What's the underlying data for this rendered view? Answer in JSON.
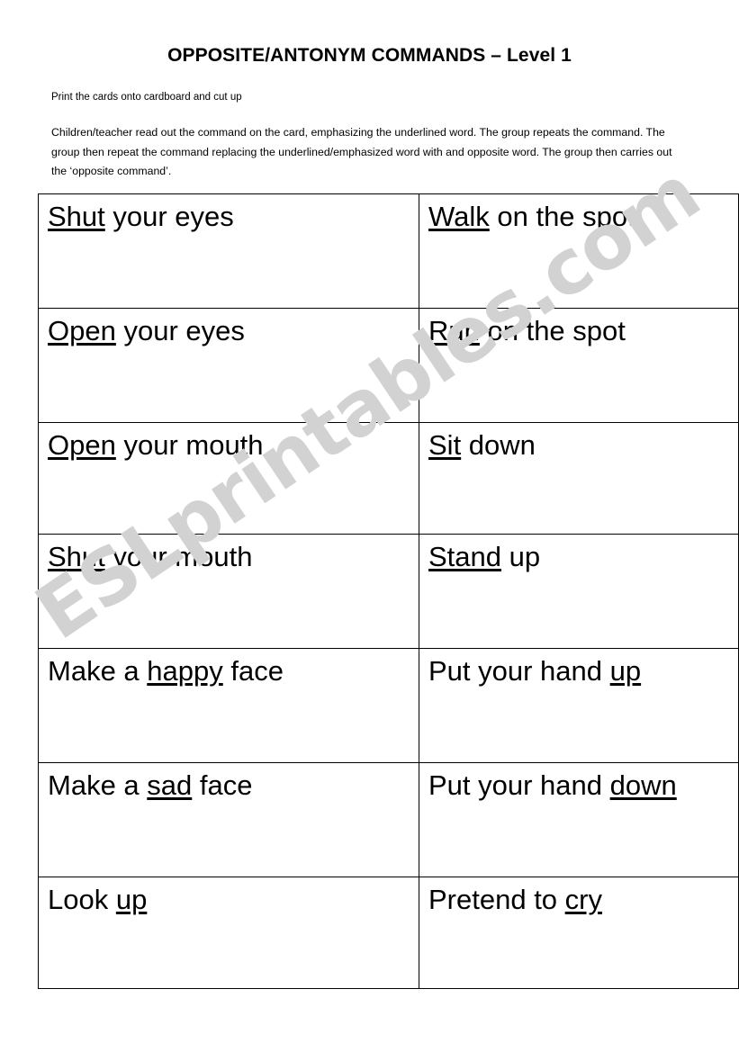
{
  "document": {
    "title": "OPPOSITE/ANTONYM COMMANDS – Level 1",
    "instruction_line": "Print the cards onto cardboard and cut up",
    "instruction_paragraph": "Children/teacher read out the command on the card, emphasizing the underlined word.  The group repeats the command.  The group then repeat the command replacing the underlined/emphasized word with and opposite word.  The group then carries out the ‘opposite command’."
  },
  "watermark": {
    "text_bold": "ESL",
    "text_rest": "printables.com",
    "full_text": "ESLprintables.com",
    "color": "#d2d2d2"
  },
  "cards": {
    "rows": [
      {
        "left": {
          "before": "",
          "emphasis": "Shut",
          "after": " your eyes"
        },
        "right": {
          "before": "",
          "emphasis": "Walk",
          "after": " on the spot"
        }
      },
      {
        "left": {
          "before": "",
          "emphasis": "Open",
          "after": " your eyes"
        },
        "right": {
          "before": "",
          "emphasis": "Run",
          "after": " on the spot"
        }
      },
      {
        "left": {
          "before": "",
          "emphasis": "Open",
          "after": " your mouth"
        },
        "right": {
          "before": "",
          "emphasis": "Sit",
          "after": " down"
        }
      },
      {
        "left": {
          "before": "",
          "emphasis": "Shut",
          "after": " your mouth"
        },
        "right": {
          "before": "",
          "emphasis": "Stand",
          "after": " up"
        }
      },
      {
        "left": {
          "before": "Make a ",
          "emphasis": "happy",
          "after": " face"
        },
        "right": {
          "before": "Put your hand ",
          "emphasis": "up",
          "after": ""
        }
      },
      {
        "left": {
          "before": "Make a ",
          "emphasis": "sad",
          "after": " face"
        },
        "right": {
          "before": "Put your hand ",
          "emphasis": "down",
          "after": ""
        }
      },
      {
        "left": {
          "before": "Look ",
          "emphasis": "up",
          "after": ""
        },
        "right": {
          "before": "Pretend to ",
          "emphasis": "cry",
          "after": ""
        }
      }
    ]
  }
}
